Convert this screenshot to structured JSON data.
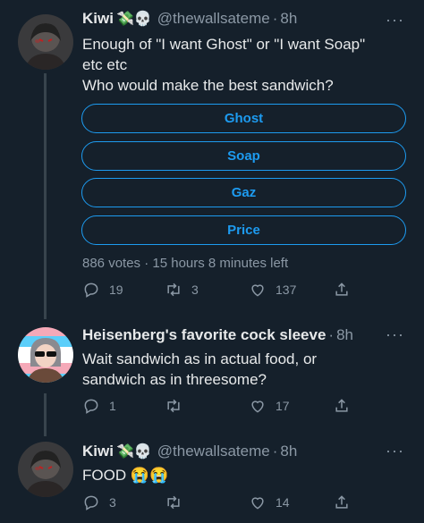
{
  "tweets": [
    {
      "name": "Kiwi",
      "emojis": "💸💀",
      "handle": "@thewallsateme",
      "time": "8h",
      "text_lines": [
        "Enough of \"I want Ghost\" or \"I want Soap\"",
        "etc etc",
        "Who would make the best sandwich?"
      ],
      "poll": {
        "options": [
          "Ghost",
          "Soap",
          "Gaz",
          "Price"
        ],
        "meta": "886 votes · 15 hours 8 minutes left"
      },
      "replies": "19",
      "retweets": "3",
      "likes": "137"
    },
    {
      "name": "Heisenberg's favorite cock sleeve",
      "handle": "",
      "time": "8h",
      "text_lines": [
        "Wait sandwich as in actual food, or",
        "sandwich as in threesome?"
      ],
      "replies": "1",
      "retweets": "",
      "likes": "17"
    },
    {
      "name": "Kiwi",
      "emojis": "💸💀",
      "handle": "@thewallsateme",
      "time": "8h",
      "text": "FOOD 😭😭",
      "replies": "3",
      "retweets": "",
      "likes": "14"
    }
  ],
  "dot": "·",
  "more_icon": "···",
  "colors": {
    "bg": "#15202b",
    "accent": "#1d9bf0",
    "muted": "#8b98a5",
    "line": "#38444d"
  }
}
